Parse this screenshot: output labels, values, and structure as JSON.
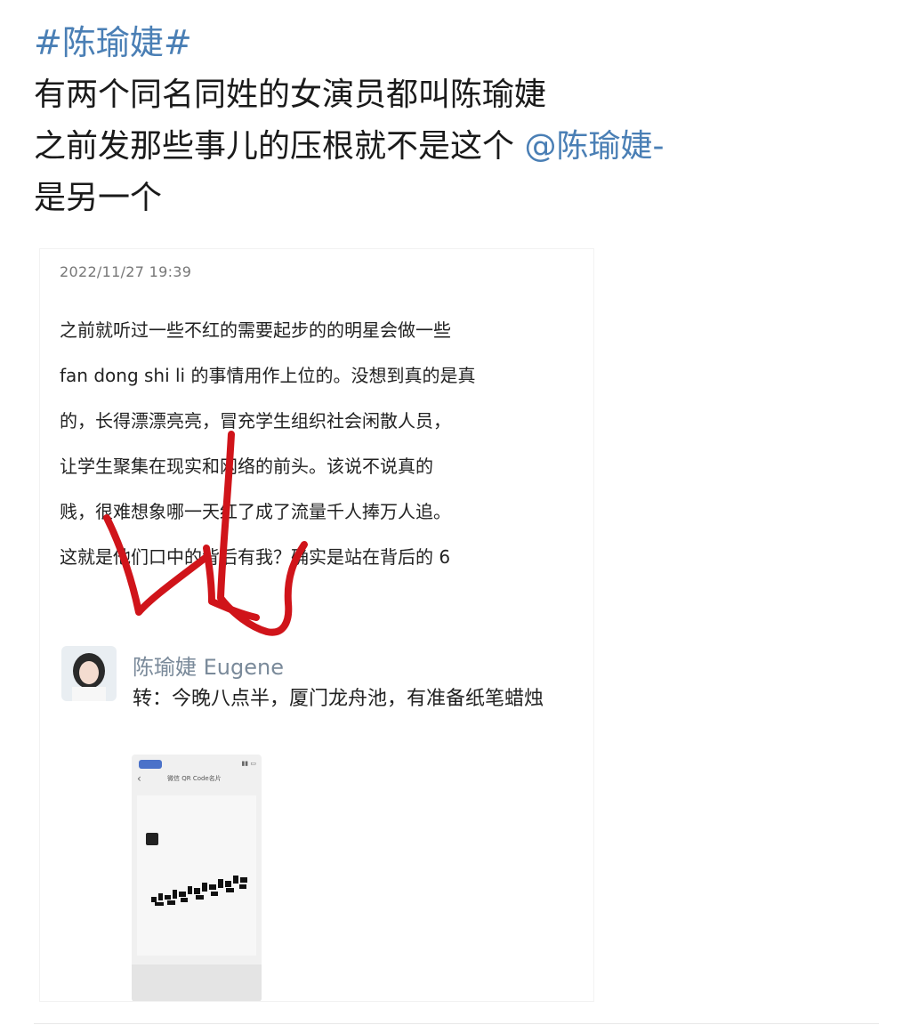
{
  "post": {
    "hashtag": "#陈瑜婕#",
    "lines": [
      "有两个同名同姓的女演员都叫陈瑜婕",
      "之前发那些事儿的压根就不是这个 "
    ],
    "mention": "@陈瑜婕-",
    "line3": "是另一个"
  },
  "screenshot": {
    "timestamp": "2022/11/27 19:39",
    "body_lines": [
      "之前就听过一些不红的需要起步的的明星会做一些",
      "fan dong shi li 的事情用作上位的。没想到真的是真",
      "的，长得漂漂亮亮，冒充学生组织社会闲散人员，",
      "让学生聚集在现实和网络的前头。该说不说真的",
      "贱，很难想象哪一天红了成了流量千人捧万人追。",
      "这就是他们口中的背后有我？确实是站在背后的 6"
    ],
    "repost": {
      "name": "陈瑜婕 Eugene",
      "text": "转：今晚八点半，厦门龙舟池，有准备纸笔蜡烛"
    },
    "phone": {
      "title": "微信 QR Code名片"
    }
  },
  "colors": {
    "link": "#4a7fb5",
    "annotation": "#d0141a"
  }
}
